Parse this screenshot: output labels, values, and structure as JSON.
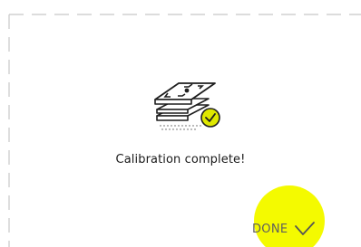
{
  "status": {
    "message": "Calibration complete!"
  },
  "actions": {
    "done_label": "DONE"
  },
  "icons": {
    "illustration": "calibration-plate-check-icon",
    "done": "check-icon"
  },
  "colors": {
    "accent": "#f4fa00",
    "text": "#1a1a1a",
    "button_text": "#5f5f5f",
    "border": "#c8c8c8",
    "badge": "#dfe800"
  }
}
